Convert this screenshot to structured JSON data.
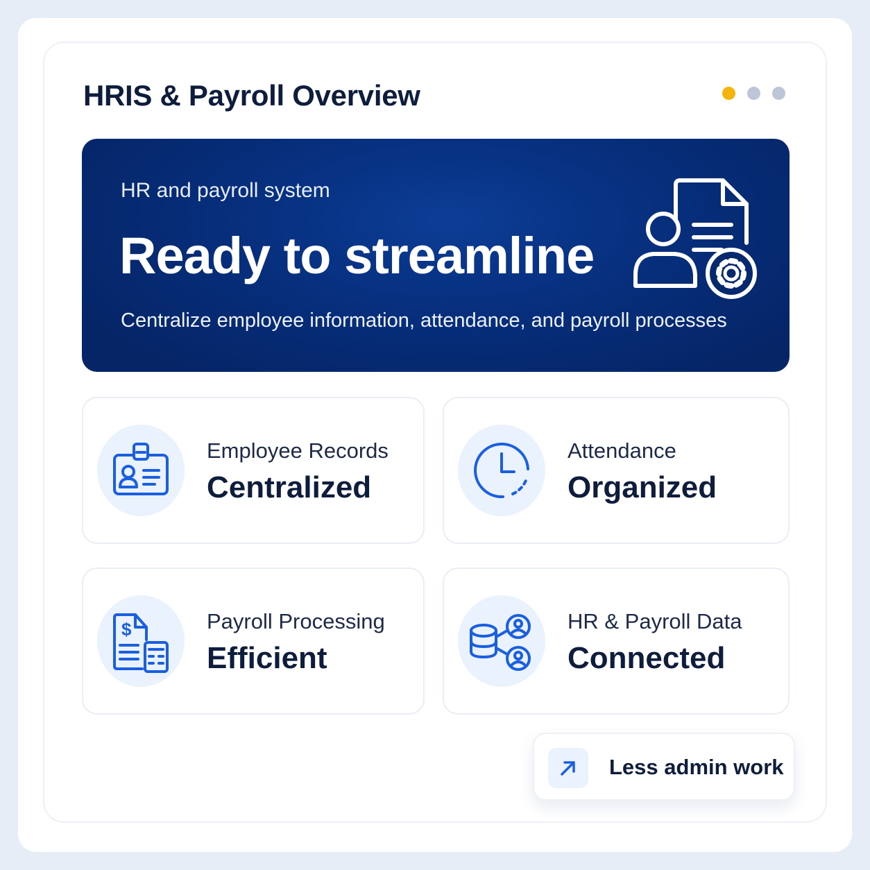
{
  "header": {
    "title": "HRIS & Payroll Overview",
    "pager": {
      "count": 3,
      "active_index": 0,
      "active_color": "#f5b40b",
      "inactive_color": "#bcc6d8"
    }
  },
  "hero": {
    "kicker": "HR and payroll system",
    "headline": "Ready to streamline",
    "description": "Centralize employee information, attendance, and payroll processes",
    "icon": "employee-document-settings-icon",
    "background_color": "#07307f"
  },
  "tiles": [
    {
      "label": "Employee Records",
      "value": "Centralized",
      "icon": "id-badge-icon"
    },
    {
      "label": "Attendance",
      "value": "Organized",
      "icon": "clock-icon"
    },
    {
      "label": "Payroll Processing",
      "value": "Efficient",
      "icon": "payroll-calculator-icon"
    },
    {
      "label": "HR & Payroll Data",
      "value": "Connected",
      "icon": "database-users-icon"
    }
  ],
  "badge": {
    "text": "Less admin work",
    "icon": "arrow-up-right-icon"
  },
  "colors": {
    "accent": "#1a5fe0",
    "heading": "#0f1d3d",
    "icon_bg": "#eaf2fd"
  }
}
